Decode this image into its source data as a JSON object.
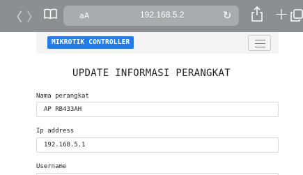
{
  "browser": {
    "text_size_label": "aA",
    "address": "192.168.5.2"
  },
  "navbar": {
    "brand": "MIKROTIK CONTROLLER"
  },
  "form": {
    "title": "UPDATE INFORMASI PERANGKAT",
    "fields": [
      {
        "label": "Nama perangkat",
        "value": "AP RB433AH"
      },
      {
        "label": "Ip address",
        "value": "192.168.5.1"
      },
      {
        "label": "Username",
        "value": ""
      }
    ]
  },
  "colors": {
    "toolbar": "#8c8e92",
    "brand_button": "#1e7cf2",
    "navbar_bg": "#f4f4f5"
  }
}
